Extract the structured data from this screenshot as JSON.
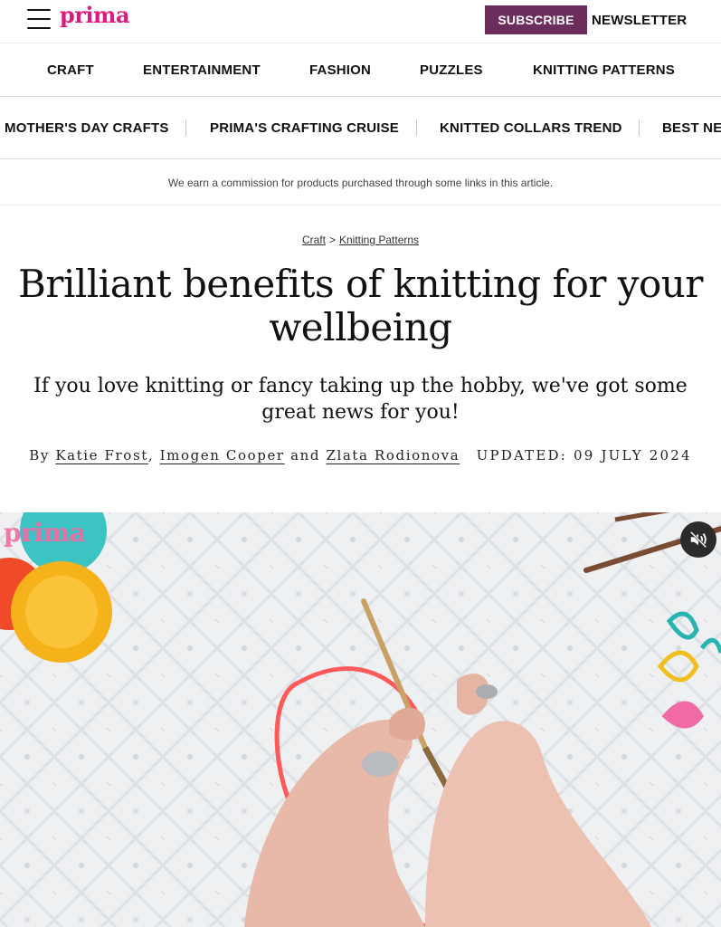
{
  "site": {
    "logo_text": "prima",
    "brand_color": "#e0197d",
    "subscribe_label": "SUBSCRIBE",
    "subscribe_color": "#6b2d5c",
    "newsletter_label": "NEWSLETTER"
  },
  "nav_main": [
    "CRAFT",
    "ENTERTAINMENT",
    "FASHION",
    "PUZZLES",
    "KNITTING PATTERNS"
  ],
  "nav_trending": [
    "MOTHER'S DAY CRAFTS",
    "PRIMA'S CRAFTING CRUISE",
    "KNITTED COLLARS TREND",
    "BEST NE"
  ],
  "disclaimer": "We earn a commission for products purchased through some links in this article.",
  "breadcrumb": {
    "first": "Craft",
    "separator": ">",
    "second": "Knitting Patterns"
  },
  "article": {
    "title": "Brilliant benefits of knitting for your wellbeing",
    "standfirst": "If you love knitting or fancy taking up the hobby, we've got some great news for you!",
    "byline_prefix": "By",
    "authors": [
      "Katie Frost",
      "Imogen Cooper",
      "Zlata Rodionova"
    ],
    "author_sep_1": ",",
    "author_sep_2": "and",
    "updated": "UPDATED: 09 JULY 2024"
  },
  "video": {
    "watermark": "prima",
    "mute_icon": "speaker-muted-icon"
  }
}
